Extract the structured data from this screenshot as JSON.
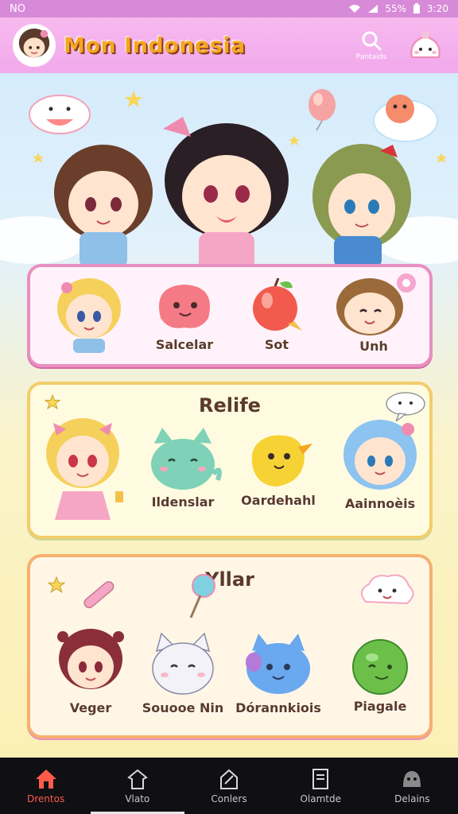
{
  "status_bar": {
    "carrier": "NO",
    "battery": "55%",
    "time": "3:20"
  },
  "header": {
    "title": "Mon Indonesia",
    "search_label": "Pantaids",
    "search_icon": "search-icon",
    "mascot_icon": "mascot-icon"
  },
  "panels": [
    {
      "title": "",
      "items": [
        {
          "label": "",
          "icon": "blonde-girl-character"
        },
        {
          "label": "Salcelar",
          "icon": "pink-blob-character"
        },
        {
          "label": "Sot",
          "icon": "apple-character"
        },
        {
          "label": "Unh",
          "icon": "brown-hair-girl-character"
        }
      ]
    },
    {
      "title": "Relife",
      "items": [
        {
          "label": "",
          "icon": "blonde-girl-pink-dress-character"
        },
        {
          "label": "Ildenslar",
          "icon": "mint-cat-character"
        },
        {
          "label": "Oardehahl",
          "icon": "yellow-bird-character"
        },
        {
          "label": "Aainnoèis",
          "icon": "blue-hair-girl-character"
        }
      ]
    },
    {
      "title": "Yllar",
      "items": [
        {
          "label": "Veger",
          "icon": "red-hair-girl-character"
        },
        {
          "label": "Souooe Nin",
          "icon": "white-cat-character"
        },
        {
          "label": "Dórannkiois",
          "icon": "blue-cat-character"
        },
        {
          "label": "Piagale",
          "icon": "green-blob-character"
        }
      ]
    }
  ],
  "bottom_nav": [
    {
      "label": "Drentos",
      "icon": "home-icon",
      "active": true
    },
    {
      "label": "Vlato",
      "icon": "shirt-icon",
      "active": false
    },
    {
      "label": "Conlers",
      "icon": "pencil-icon",
      "active": false
    },
    {
      "label": "Olamtde",
      "icon": "document-icon",
      "active": false
    },
    {
      "label": "Delains",
      "icon": "alien-icon",
      "active": false
    }
  ],
  "colors": {
    "header": "#f1a9ec",
    "accent": "#ff5a4a",
    "title": "#f5a623"
  }
}
